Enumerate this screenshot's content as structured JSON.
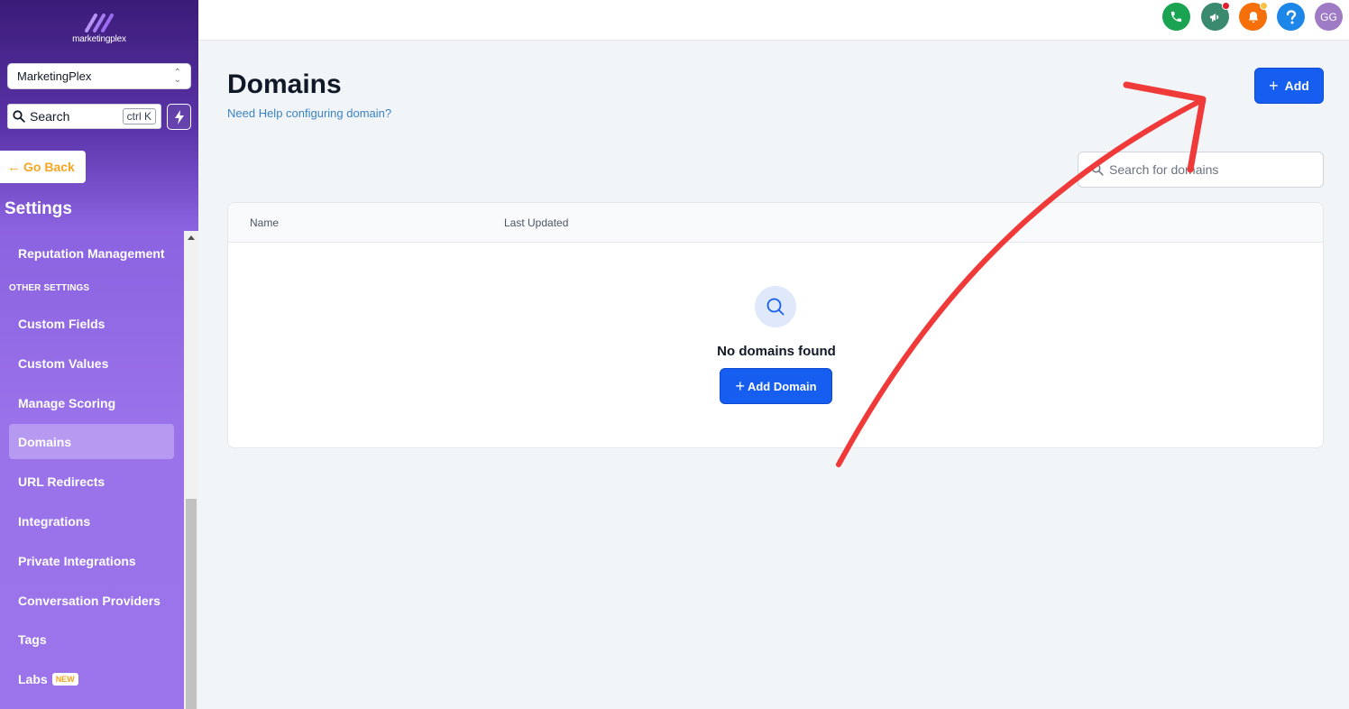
{
  "brand": {
    "logo_text": "marketingplex"
  },
  "sidebar": {
    "account_name": "MarketingPlex",
    "search_label": "Search",
    "search_shortcut": "ctrl K",
    "go_back_label": "Go Back",
    "section_title": "Settings",
    "items": [
      {
        "label": "Reputation Management"
      },
      {
        "section": "OTHER SETTINGS"
      },
      {
        "label": "Custom Fields"
      },
      {
        "label": "Custom Values"
      },
      {
        "label": "Manage Scoring"
      },
      {
        "label": "Domains",
        "active": true
      },
      {
        "label": "URL Redirects"
      },
      {
        "label": "Integrations"
      },
      {
        "label": "Private Integrations"
      },
      {
        "label": "Conversation Providers"
      },
      {
        "label": "Tags"
      },
      {
        "label": "Labs",
        "badge": "NEW"
      }
    ]
  },
  "topbar": {
    "icons": [
      "phone-icon",
      "megaphone-icon",
      "bell-icon",
      "help-icon"
    ],
    "avatar_initials": "GG"
  },
  "main": {
    "title": "Domains",
    "help_link": "Need Help configuring domain?",
    "add_button": "Add",
    "search_placeholder": "Search for domains",
    "table": {
      "columns": [
        "Name",
        "Last Updated"
      ],
      "empty_text": "No domains found",
      "empty_button": "Add Domain"
    }
  },
  "colors": {
    "primary": "#155eef",
    "sidebar_purple": "#9b73eb",
    "accent_orange": "#f5a623",
    "annotation_red": "#f03a3a"
  }
}
